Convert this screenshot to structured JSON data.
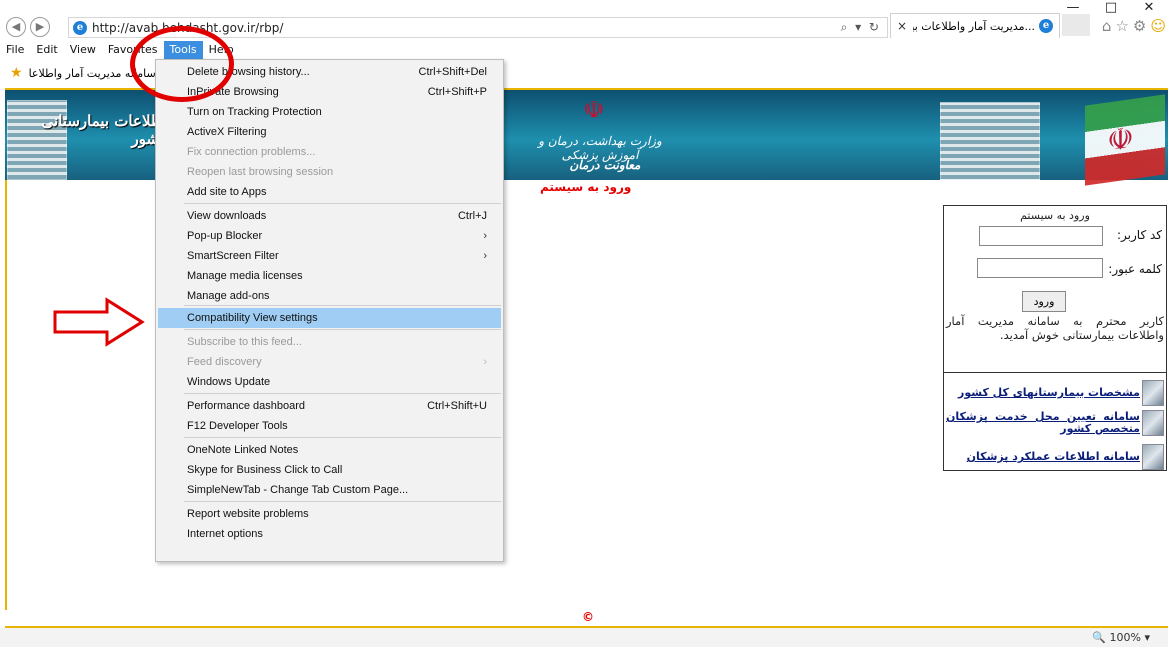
{
  "browser": {
    "url": "http://avab.behdasht.gov.ir/rbp/",
    "tab_title": "...مدیریت آمار واطلاعات بیمار",
    "tab_close": "×",
    "address_tools": "⌕ ▾ ↻",
    "window_controls": [
      "—",
      "□",
      "✕"
    ],
    "favorites_item": "سامانه مدیریت آمار واطلاعا",
    "menubar": [
      "File",
      "Edit",
      "View",
      "Favorites",
      "Tools",
      "Help"
    ],
    "active_menu": "Tools"
  },
  "tools_menu": {
    "items": [
      {
        "label": "Delete browsing history...",
        "shortcut": "Ctrl+Shift+Del"
      },
      {
        "label": "InPrivate Browsing",
        "shortcut": "Ctrl+Shift+P"
      },
      {
        "label": "Turn on Tracking Protection"
      },
      {
        "label": "ActiveX Filtering"
      },
      {
        "label": "Fix connection problems...",
        "disabled": true
      },
      {
        "label": "Reopen last browsing session",
        "disabled": true
      },
      {
        "label": "Add site to Apps"
      },
      {
        "label": "View downloads",
        "shortcut": "Ctrl+J"
      },
      {
        "label": "Pop-up Blocker",
        "submenu": true
      },
      {
        "label": "SmartScreen Filter",
        "submenu": true
      },
      {
        "label": "Manage media licenses"
      },
      {
        "label": "Manage add-ons"
      },
      {
        "label": "Compatibility View settings",
        "highlighted": true
      },
      {
        "label": "Subscribe to this feed...",
        "disabled": true
      },
      {
        "label": "Feed discovery",
        "disabled": true,
        "submenu": true
      },
      {
        "label": "Windows Update"
      },
      {
        "label": "Performance dashboard",
        "shortcut": "Ctrl+Shift+U"
      },
      {
        "label": "F12 Developer Tools"
      },
      {
        "label": "OneNote Linked Notes"
      },
      {
        "label": "Skype for Business Click to Call"
      },
      {
        "label": "SimpleNewTab - Change Tab Custom Page..."
      },
      {
        "label": "Report website problems"
      },
      {
        "label": "Internet options"
      }
    ]
  },
  "banner": {
    "left_title": "اطلاعات بیمارستانی کشور",
    "emblem": "☫",
    "ministry": "وزارت بهداشت، درمان و آموزش پزشکی",
    "deputy": "معاونت درمان"
  },
  "page": {
    "login_link": "ورود به سیستم",
    "copyright": "©",
    "zoom": "🔍 100%  ▾"
  },
  "login": {
    "header": "ورود به سیستم",
    "username_label": "کد کاربر:",
    "password_label": "کلمه عبور:",
    "button": "ورود",
    "welcome": "کاربر محترم به سامانه مدیریت آمار واطلاعات بیمارستانی خوش آمدید."
  },
  "services": [
    "مشخصات بیمارستانهای کل کشور",
    "سامانه تعیین محل خدمت پزشکان متخصص کشور",
    "سامانه اطلاعات عملکرد پزشکان"
  ],
  "annotations": {
    "accent_color": "#e10000"
  }
}
